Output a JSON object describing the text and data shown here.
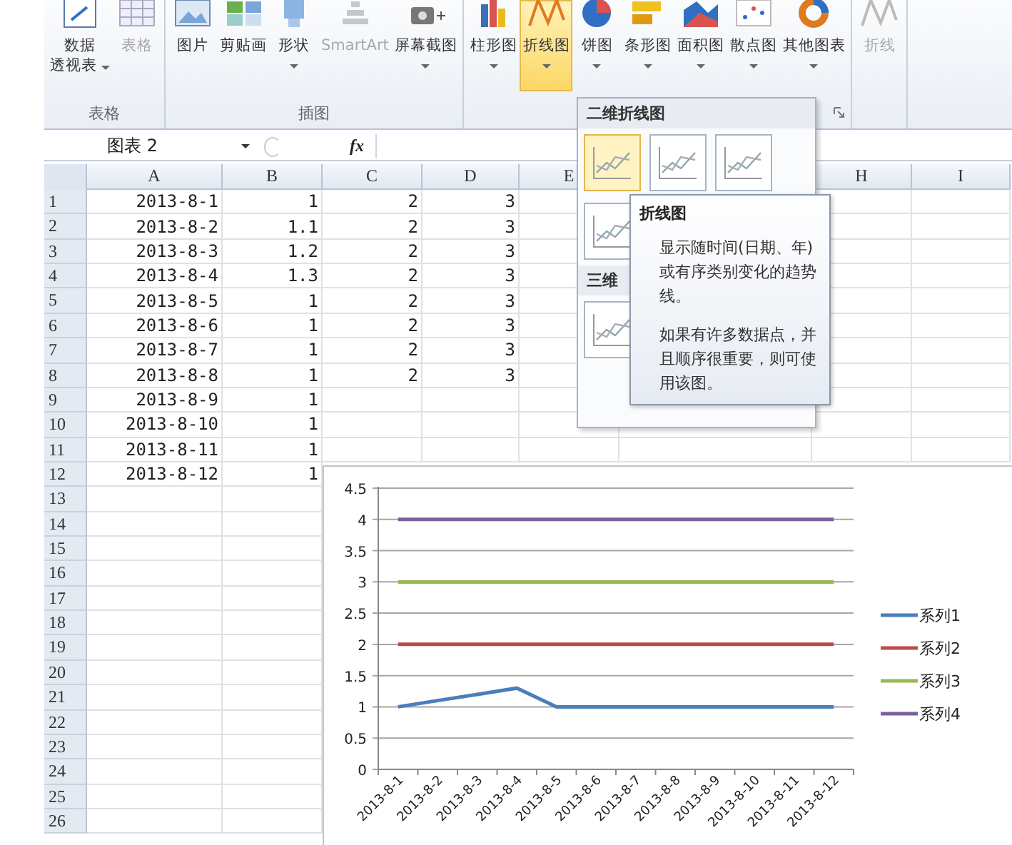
{
  "ribbon": {
    "groups": [
      {
        "label": "表格",
        "dialog_launcher": false,
        "items": [
          {
            "kind": "pivot",
            "lines": [
              "数据",
              "透视表"
            ],
            "dropdown": true,
            "disabled": false,
            "selected": false
          },
          {
            "kind": "table",
            "lines": [
              "表格"
            ],
            "dropdown": false,
            "disabled": true,
            "selected": false
          }
        ]
      },
      {
        "label": "插图",
        "dialog_launcher": false,
        "items": [
          {
            "kind": "picture",
            "lines": [
              "图片"
            ],
            "dropdown": false,
            "disabled": false,
            "selected": false
          },
          {
            "kind": "clipart",
            "lines": [
              "剪贴画"
            ],
            "dropdown": false,
            "disabled": false,
            "selected": false
          },
          {
            "kind": "shapes",
            "lines": [
              "形状"
            ],
            "dropdown": true,
            "disabled": false,
            "selected": false
          },
          {
            "kind": "smartart",
            "lines": [
              "SmartArt"
            ],
            "dropdown": false,
            "disabled": true,
            "selected": false
          },
          {
            "kind": "screenshot",
            "lines": [
              "屏幕截图"
            ],
            "dropdown": true,
            "disabled": false,
            "selected": false
          }
        ]
      },
      {
        "dialog_launcher": true,
        "items": [
          {
            "kind": "column",
            "lines": [
              "柱形图"
            ],
            "dropdown": true,
            "disabled": false,
            "selected": false
          },
          {
            "kind": "line",
            "lines": [
              "折线图"
            ],
            "dropdown": true,
            "disabled": false,
            "selected": true
          },
          {
            "kind": "pie",
            "lines": [
              "饼图"
            ],
            "dropdown": true,
            "disabled": false,
            "selected": false
          },
          {
            "kind": "bar",
            "lines": [
              "条形图"
            ],
            "dropdown": true,
            "disabled": false,
            "selected": false
          },
          {
            "kind": "area",
            "lines": [
              "面积图"
            ],
            "dropdown": true,
            "disabled": false,
            "selected": false
          },
          {
            "kind": "scatter",
            "lines": [
              "散点图"
            ],
            "dropdown": true,
            "disabled": false,
            "selected": false
          },
          {
            "kind": "other",
            "lines": [
              "其他图表"
            ],
            "dropdown": true,
            "disabled": false,
            "selected": false
          }
        ]
      },
      {
        "dialog_launcher": false,
        "items": [
          {
            "kind": "line",
            "lines": [
              "折线"
            ],
            "dropdown": false,
            "disabled": true,
            "selected": false
          }
        ]
      }
    ]
  },
  "formula_bar": {
    "name_box": "图表 2",
    "function_label": "fx"
  },
  "sheet": {
    "columns": [
      "A",
      "B",
      "C",
      "D",
      "E",
      "H",
      "I"
    ],
    "rows": [
      {
        "number": "1",
        "cells": [
          "2013-8-1",
          "1",
          "2",
          "3"
        ]
      },
      {
        "number": "2",
        "cells": [
          "2013-8-2",
          "1.1",
          "2",
          "3"
        ]
      },
      {
        "number": "3",
        "cells": [
          "2013-8-3",
          "1.2",
          "2",
          "3"
        ]
      },
      {
        "number": "4",
        "cells": [
          "2013-8-4",
          "1.3",
          "2",
          "3"
        ]
      },
      {
        "number": "5",
        "cells": [
          "2013-8-5",
          "1",
          "2",
          "3"
        ]
      },
      {
        "number": "6",
        "cells": [
          "2013-8-6",
          "1",
          "2",
          "3"
        ]
      },
      {
        "number": "7",
        "cells": [
          "2013-8-7",
          "1",
          "2",
          "3"
        ]
      },
      {
        "number": "8",
        "cells": [
          "2013-8-8",
          "1",
          "2",
          "3"
        ]
      },
      {
        "number": "9",
        "cells": [
          "2013-8-9",
          "1"
        ]
      },
      {
        "number": "10",
        "cells": [
          "2013-8-10",
          "1"
        ]
      },
      {
        "number": "11",
        "cells": [
          "2013-8-11",
          "1"
        ]
      },
      {
        "number": "12",
        "cells": [
          "2013-8-12",
          "1"
        ]
      },
      {
        "number": "13",
        "cells": []
      },
      {
        "number": "14",
        "cells": []
      },
      {
        "number": "15",
        "cells": []
      },
      {
        "number": "16",
        "cells": []
      },
      {
        "number": "17",
        "cells": []
      },
      {
        "number": "18",
        "cells": []
      },
      {
        "number": "19",
        "cells": []
      },
      {
        "number": "20",
        "cells": []
      },
      {
        "number": "21",
        "cells": []
      },
      {
        "number": "22",
        "cells": []
      },
      {
        "number": "23",
        "cells": []
      },
      {
        "number": "24",
        "cells": []
      },
      {
        "number": "25",
        "cells": []
      },
      {
        "number": "26",
        "cells": []
      }
    ]
  },
  "chart_menu": {
    "sections": [
      {
        "title": "二维折线图",
        "options": [
          {
            "selected": true
          },
          {
            "selected": false
          },
          {
            "selected": false
          },
          {
            "selected": false
          }
        ]
      },
      {
        "title": "三维",
        "options": [
          {
            "selected": false
          }
        ]
      }
    ]
  },
  "tooltip": {
    "title": "折线图",
    "paragraphs": [
      "显示随时间(日期、年)或有序类别变化的趋势线。",
      "如果有许多数据点，并且顺序很重要，则可使用该图。"
    ]
  },
  "chart": {
    "chart_data": {
      "type": "line",
      "grid": true,
      "legend": true,
      "categories": [
        "2013-8-1",
        "2013-8-2",
        "2013-8-3",
        "2013-8-4",
        "2013-8-5",
        "2013-8-6",
        "2013-8-7",
        "2013-8-8",
        "2013-8-9",
        "2013-8-10",
        "2013-8-11",
        "2013-8-12"
      ],
      "ylim": [
        0,
        4.5
      ],
      "yticks": [
        0,
        0.5,
        1,
        1.5,
        2,
        2.5,
        3,
        3.5,
        4,
        4.5
      ],
      "series": [
        {
          "name": "系列1",
          "color": "#4a7ebb",
          "values": [
            1,
            1.1,
            1.2,
            1.3,
            1,
            1,
            1,
            1,
            1,
            1,
            1,
            1
          ]
        },
        {
          "name": "系列2",
          "color": "#be4b48",
          "values": [
            2,
            2,
            2,
            2,
            2,
            2,
            2,
            2,
            2,
            2,
            2,
            2
          ]
        },
        {
          "name": "系列3",
          "color": "#98b954",
          "values": [
            3,
            3,
            3,
            3,
            3,
            3,
            3,
            3,
            3,
            3,
            3,
            3
          ]
        },
        {
          "name": "系列4",
          "color": "#7d60a0",
          "values": [
            4,
            4,
            4,
            4,
            4,
            4,
            4,
            4,
            4,
            4,
            4,
            4
          ]
        }
      ]
    }
  }
}
